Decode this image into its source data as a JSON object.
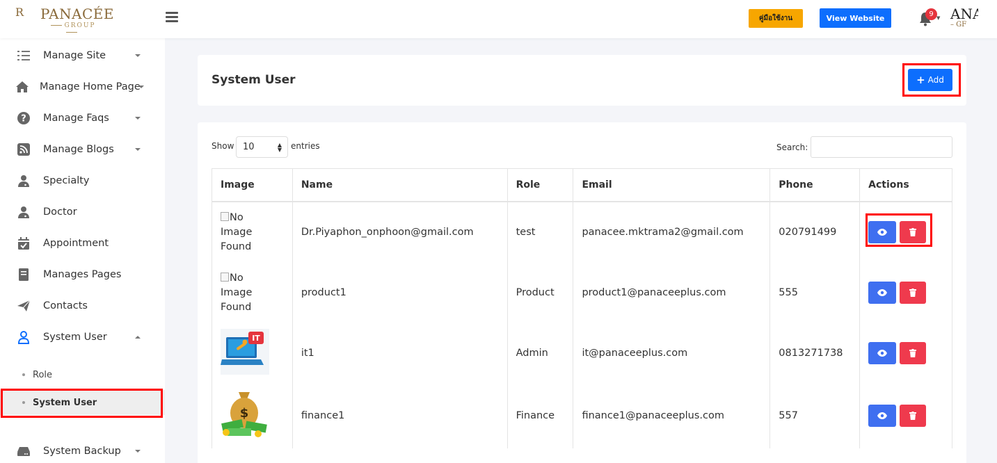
{
  "header": {
    "logo_mono": "R",
    "logo_brand": "PANACÉE",
    "logo_sub": "GROUP",
    "manual_label": "คู่มือใช้งาน",
    "view_website_label": "View Website",
    "notification_count": "9",
    "user_logo_top": "ANA",
    "user_logo_bottom": "– GF"
  },
  "sidebar": {
    "items": [
      {
        "label": "Manage Site",
        "icon": "list-icon"
      },
      {
        "label": "Manage Home Page",
        "icon": "home-icon"
      },
      {
        "label": "Manage Faqs",
        "icon": "question-icon"
      },
      {
        "label": "Manage Blogs",
        "icon": "rss-icon"
      },
      {
        "label": "Specialty",
        "icon": "user-doctor-icon"
      },
      {
        "label": "Doctor",
        "icon": "user-doctor-icon"
      },
      {
        "label": "Appointment",
        "icon": "calendar-check-icon"
      },
      {
        "label": "Manages Pages",
        "icon": "book-icon"
      },
      {
        "label": "Contacts",
        "icon": "paper-plane-icon"
      },
      {
        "label": "System User",
        "icon": "user-icon"
      },
      {
        "label": "System Backup",
        "icon": "hdd-icon"
      }
    ],
    "subitems": [
      {
        "label": "Role"
      },
      {
        "label": "System User"
      }
    ]
  },
  "page": {
    "title": "System User",
    "add_label": "Add"
  },
  "table": {
    "show_label": "Show",
    "entries_value": "10",
    "entries_label": "entries",
    "search_label": "Search:",
    "columns": [
      "Image",
      "Name",
      "Role",
      "Email",
      "Phone",
      "Actions"
    ],
    "rows": [
      {
        "image_alt": [
          "No",
          "Image",
          "Found"
        ],
        "name": "Dr.Piyaphon_onphoon@gmail.com",
        "role": "test",
        "email": "panacee.mktrama2@gmail.com",
        "phone": "020791499"
      },
      {
        "image_alt": [
          "No",
          "Image",
          "Found"
        ],
        "name": "product1",
        "role": "Product",
        "email": "product1@panaceeplus.com",
        "phone": "555"
      },
      {
        "image_icon": "it-laptop-icon",
        "image_badge": "IT",
        "name": "it1",
        "role": "Admin",
        "email": "it@panaceeplus.com",
        "phone": "0813271738"
      },
      {
        "image_icon": "money-bag-icon",
        "image_badge": "$",
        "name": "finance1",
        "role": "Finance",
        "email": "finance1@panaceeplus.com",
        "phone": "557"
      }
    ]
  },
  "colors": {
    "primary": "#0d6efd",
    "manual_button": "#f7a600",
    "danger": "#ef3a4d",
    "view_button": "#3f6ff0",
    "highlight": "#ff0000",
    "accent_active": "#0d6efd"
  }
}
